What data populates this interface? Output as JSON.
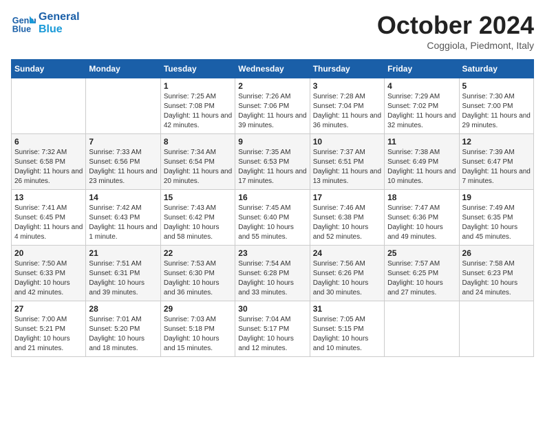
{
  "header": {
    "logo_line1": "General",
    "logo_line2": "Blue",
    "month": "October 2024",
    "location": "Coggiola, Piedmont, Italy"
  },
  "days_of_week": [
    "Sunday",
    "Monday",
    "Tuesday",
    "Wednesday",
    "Thursday",
    "Friday",
    "Saturday"
  ],
  "weeks": [
    [
      {
        "day": "",
        "info": ""
      },
      {
        "day": "",
        "info": ""
      },
      {
        "day": "1",
        "info": "Sunrise: 7:25 AM\nSunset: 7:08 PM\nDaylight: 11 hours and 42 minutes."
      },
      {
        "day": "2",
        "info": "Sunrise: 7:26 AM\nSunset: 7:06 PM\nDaylight: 11 hours and 39 minutes."
      },
      {
        "day": "3",
        "info": "Sunrise: 7:28 AM\nSunset: 7:04 PM\nDaylight: 11 hours and 36 minutes."
      },
      {
        "day": "4",
        "info": "Sunrise: 7:29 AM\nSunset: 7:02 PM\nDaylight: 11 hours and 32 minutes."
      },
      {
        "day": "5",
        "info": "Sunrise: 7:30 AM\nSunset: 7:00 PM\nDaylight: 11 hours and 29 minutes."
      }
    ],
    [
      {
        "day": "6",
        "info": "Sunrise: 7:32 AM\nSunset: 6:58 PM\nDaylight: 11 hours and 26 minutes."
      },
      {
        "day": "7",
        "info": "Sunrise: 7:33 AM\nSunset: 6:56 PM\nDaylight: 11 hours and 23 minutes."
      },
      {
        "day": "8",
        "info": "Sunrise: 7:34 AM\nSunset: 6:54 PM\nDaylight: 11 hours and 20 minutes."
      },
      {
        "day": "9",
        "info": "Sunrise: 7:35 AM\nSunset: 6:53 PM\nDaylight: 11 hours and 17 minutes."
      },
      {
        "day": "10",
        "info": "Sunrise: 7:37 AM\nSunset: 6:51 PM\nDaylight: 11 hours and 13 minutes."
      },
      {
        "day": "11",
        "info": "Sunrise: 7:38 AM\nSunset: 6:49 PM\nDaylight: 11 hours and 10 minutes."
      },
      {
        "day": "12",
        "info": "Sunrise: 7:39 AM\nSunset: 6:47 PM\nDaylight: 11 hours and 7 minutes."
      }
    ],
    [
      {
        "day": "13",
        "info": "Sunrise: 7:41 AM\nSunset: 6:45 PM\nDaylight: 11 hours and 4 minutes."
      },
      {
        "day": "14",
        "info": "Sunrise: 7:42 AM\nSunset: 6:43 PM\nDaylight: 11 hours and 1 minute."
      },
      {
        "day": "15",
        "info": "Sunrise: 7:43 AM\nSunset: 6:42 PM\nDaylight: 10 hours and 58 minutes."
      },
      {
        "day": "16",
        "info": "Sunrise: 7:45 AM\nSunset: 6:40 PM\nDaylight: 10 hours and 55 minutes."
      },
      {
        "day": "17",
        "info": "Sunrise: 7:46 AM\nSunset: 6:38 PM\nDaylight: 10 hours and 52 minutes."
      },
      {
        "day": "18",
        "info": "Sunrise: 7:47 AM\nSunset: 6:36 PM\nDaylight: 10 hours and 49 minutes."
      },
      {
        "day": "19",
        "info": "Sunrise: 7:49 AM\nSunset: 6:35 PM\nDaylight: 10 hours and 45 minutes."
      }
    ],
    [
      {
        "day": "20",
        "info": "Sunrise: 7:50 AM\nSunset: 6:33 PM\nDaylight: 10 hours and 42 minutes."
      },
      {
        "day": "21",
        "info": "Sunrise: 7:51 AM\nSunset: 6:31 PM\nDaylight: 10 hours and 39 minutes."
      },
      {
        "day": "22",
        "info": "Sunrise: 7:53 AM\nSunset: 6:30 PM\nDaylight: 10 hours and 36 minutes."
      },
      {
        "day": "23",
        "info": "Sunrise: 7:54 AM\nSunset: 6:28 PM\nDaylight: 10 hours and 33 minutes."
      },
      {
        "day": "24",
        "info": "Sunrise: 7:56 AM\nSunset: 6:26 PM\nDaylight: 10 hours and 30 minutes."
      },
      {
        "day": "25",
        "info": "Sunrise: 7:57 AM\nSunset: 6:25 PM\nDaylight: 10 hours and 27 minutes."
      },
      {
        "day": "26",
        "info": "Sunrise: 7:58 AM\nSunset: 6:23 PM\nDaylight: 10 hours and 24 minutes."
      }
    ],
    [
      {
        "day": "27",
        "info": "Sunrise: 7:00 AM\nSunset: 5:21 PM\nDaylight: 10 hours and 21 minutes."
      },
      {
        "day": "28",
        "info": "Sunrise: 7:01 AM\nSunset: 5:20 PM\nDaylight: 10 hours and 18 minutes."
      },
      {
        "day": "29",
        "info": "Sunrise: 7:03 AM\nSunset: 5:18 PM\nDaylight: 10 hours and 15 minutes."
      },
      {
        "day": "30",
        "info": "Sunrise: 7:04 AM\nSunset: 5:17 PM\nDaylight: 10 hours and 12 minutes."
      },
      {
        "day": "31",
        "info": "Sunrise: 7:05 AM\nSunset: 5:15 PM\nDaylight: 10 hours and 10 minutes."
      },
      {
        "day": "",
        "info": ""
      },
      {
        "day": "",
        "info": ""
      }
    ]
  ]
}
